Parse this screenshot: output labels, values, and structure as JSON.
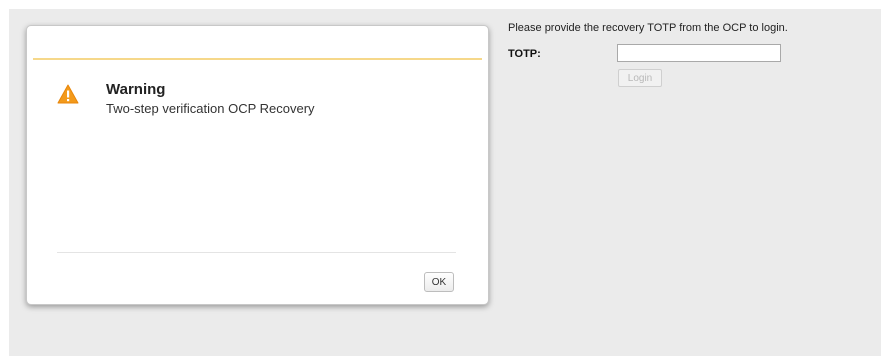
{
  "login": {
    "prompt": "Please provide the recovery TOTP from the OCP to login.",
    "totp_label": "TOTP:",
    "totp_value": "",
    "login_label": "Login"
  },
  "dialog": {
    "icon": "warning-icon",
    "title": "Warning",
    "message": "Two-step verification OCP Recovery",
    "ok_label": "OK",
    "accent_color": "#f6d88a",
    "icon_color": "#f39a1b"
  }
}
